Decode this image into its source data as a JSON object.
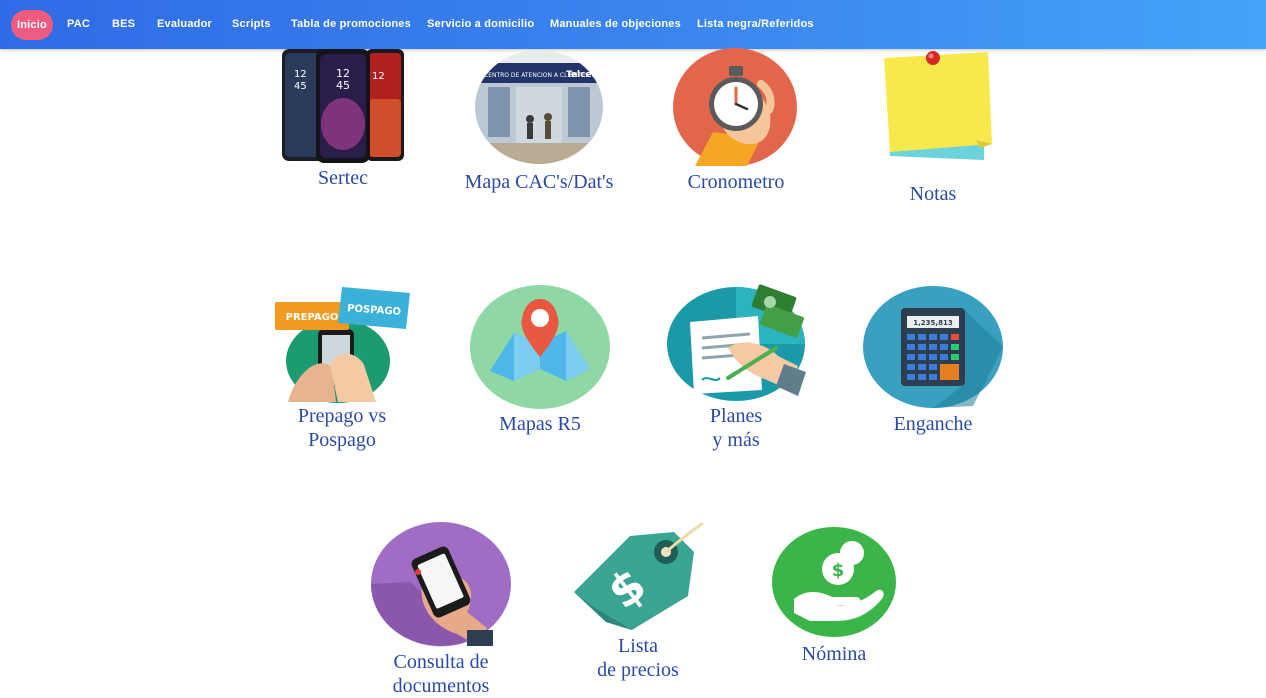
{
  "nav": {
    "items": [
      "Inicio",
      "PAC",
      "BES",
      "Evaluador",
      "Scripts",
      "Tabla de promociones",
      "Servicio a domicilio",
      "Manuales de objeciones",
      "Lista negra/Referidos"
    ],
    "active_index": 0
  },
  "tiles": [
    {
      "label_lines": [
        "Sertec"
      ],
      "icon": "smartphones-icon"
    },
    {
      "label_lines": [
        "Mapa CAC's/Dat's"
      ],
      "icon": "store-photo-icon",
      "store_sign": "CENTRO DE ATENCION A CLIENTES",
      "brand": "Telcel"
    },
    {
      "label_lines": [
        "Cronometro"
      ],
      "icon": "stopwatch-icon"
    },
    {
      "label_lines": [
        "Notas"
      ],
      "icon": "sticky-note-icon"
    },
    {
      "label_lines": [
        "Prepago vs",
        "Pospago"
      ],
      "icon": "prepago-pospago-icon",
      "badge_left": "PREPAGO",
      "badge_right": "POSPAGO"
    },
    {
      "label_lines": [
        "Mapas R5"
      ],
      "icon": "map-pin-icon"
    },
    {
      "label_lines": [
        "Planes",
        "y más"
      ],
      "icon": "contract-signing-icon"
    },
    {
      "label_lines": [
        "Enganche"
      ],
      "icon": "calculator-icon",
      "display": "1,235,813"
    },
    {
      "label_lines": [
        "Consulta de",
        "documentos"
      ],
      "icon": "phone-in-hand-icon"
    },
    {
      "label_lines": [
        "Lista",
        "de precios"
      ],
      "icon": "price-tag-icon"
    },
    {
      "label_lines": [
        "Nómina"
      ],
      "icon": "money-hand-icon"
    }
  ],
  "colors": {
    "nav_start": "#2f6be6",
    "nav_end": "#44a3f7",
    "active_pill": "#ef5c80",
    "label": "#2a4aa5"
  }
}
